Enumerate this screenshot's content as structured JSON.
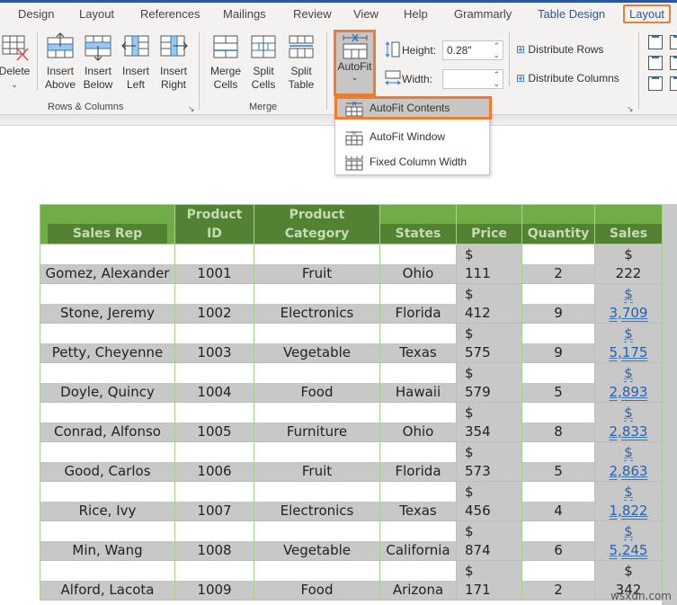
{
  "tabs": [
    {
      "label": "Design"
    },
    {
      "label": "Layout"
    },
    {
      "label": "References"
    },
    {
      "label": "Mailings"
    },
    {
      "label": "Review"
    },
    {
      "label": "View"
    },
    {
      "label": "Help"
    },
    {
      "label": "Grammarly"
    },
    {
      "label": "Table Design"
    },
    {
      "label": "Layout",
      "active": true
    }
  ],
  "ribbon": {
    "rows_columns": {
      "label": "Rows & Columns",
      "delete": "Delete",
      "insert_above": [
        "Insert",
        "Above"
      ],
      "insert_below": [
        "Insert",
        "Below"
      ],
      "insert_left": [
        "Insert",
        "Left"
      ],
      "insert_right": [
        "Insert",
        "Right"
      ]
    },
    "merge": {
      "label": "Merge",
      "merge_cells": [
        "Merge",
        "Cells"
      ],
      "split_cells": [
        "Split",
        "Cells"
      ],
      "split_table": [
        "Split",
        "Table"
      ]
    },
    "cell_size": {
      "autofit": "AutoFit",
      "height_label": "Height:",
      "height_value": "0.28\"",
      "width_label": "Width:",
      "width_value": "",
      "distribute_rows": "Distribute Rows",
      "distribute_columns": "Distribute Columns"
    }
  },
  "autofit_menu": {
    "items": [
      {
        "label": "AutoFit Contents",
        "highlighted": true
      },
      {
        "label": "AutoFit Window"
      },
      {
        "label": "Fixed Column Width"
      }
    ]
  },
  "table": {
    "headers": [
      [
        "Sales Rep"
      ],
      [
        "Product",
        "ID"
      ],
      [
        "Product",
        "Category"
      ],
      [
        "States"
      ],
      [
        "Price"
      ],
      [
        "Quantity"
      ],
      [
        "Sales"
      ]
    ],
    "rows": [
      {
        "rep": "Gomez, Alexander",
        "id": "1001",
        "cat": "Fruit",
        "state": "Ohio",
        "price": "111",
        "qty": "2",
        "sales": "222",
        "sales_ul": false
      },
      {
        "rep": "Stone, Jeremy",
        "id": "1002",
        "cat": "Electronics",
        "state": "Florida",
        "price": "412",
        "qty": "9",
        "sales": "3,709",
        "sales_ul": true
      },
      {
        "rep": "Petty, Cheyenne",
        "id": "1003",
        "cat": "Vegetable",
        "state": "Texas",
        "price": "575",
        "qty": "9",
        "sales": "5,175",
        "sales_ul": true
      },
      {
        "rep": "Doyle, Quincy",
        "id": "1004",
        "cat": "Food",
        "state": "Hawaii",
        "price": "579",
        "qty": "5",
        "sales": "2,893",
        "sales_ul": true
      },
      {
        "rep": "Conrad, Alfonso",
        "id": "1005",
        "cat": "Furniture",
        "state": "Ohio",
        "price": "354",
        "qty": "8",
        "sales": "2,833",
        "sales_ul": true
      },
      {
        "rep": "Good, Carlos",
        "id": "1006",
        "cat": "Fruit",
        "state": "Florida",
        "price": "573",
        "qty": "5",
        "sales": "2,863",
        "sales_ul": true
      },
      {
        "rep": "Rice, Ivy",
        "id": "1007",
        "cat": "Electronics",
        "state": "Texas",
        "price": "456",
        "qty": "4",
        "sales": "1,822",
        "sales_ul": true
      },
      {
        "rep": "Min, Wang",
        "id": "1008",
        "cat": "Vegetable",
        "state": "California",
        "price": "874",
        "qty": "6",
        "sales": "5,245",
        "sales_ul": true
      },
      {
        "rep": "Alford, Lacota",
        "id": "1009",
        "cat": "Food",
        "state": "Arizona",
        "price": "171",
        "qty": "2",
        "sales": "342",
        "sales_ul": false
      }
    ],
    "currency": "$"
  },
  "watermark": "wsxdn.com"
}
